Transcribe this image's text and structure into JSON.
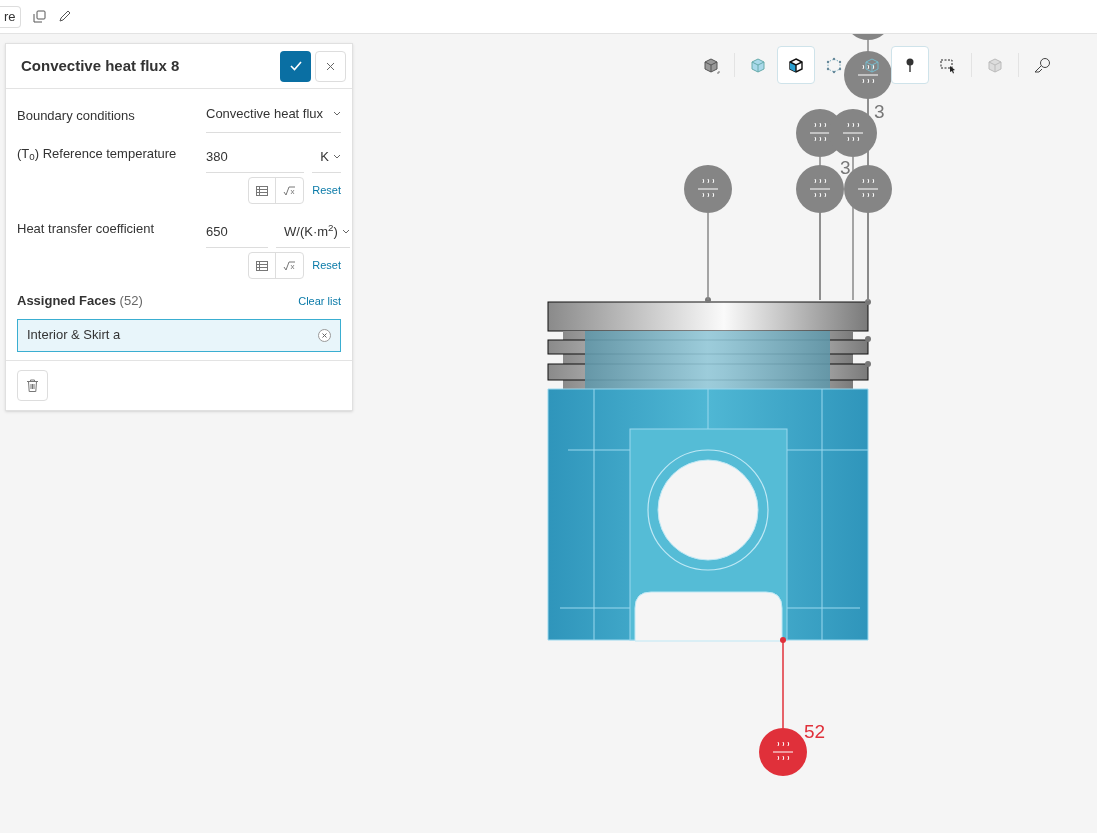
{
  "top_bar": {
    "button_label": "re"
  },
  "panel": {
    "title": "Convective heat flux 8",
    "rows": [
      {
        "kind": "select",
        "label": "Boundary conditions",
        "value": "Convective heat flux"
      },
      {
        "kind": "quantity",
        "label": "(T$_{0}$) Reference temperature",
        "value": "380",
        "unit": "K",
        "reset": "Reset"
      },
      {
        "kind": "quantity",
        "label": "Heat transfer coefficient",
        "value": "650",
        "unit": "W/(K·m$^{2}$)",
        "reset": "Reset"
      }
    ],
    "assigned": {
      "title": "Assigned Faces",
      "count": "(52)",
      "clear": "Clear list",
      "item": "Interior & Skirt a"
    }
  },
  "toolbar": [
    {
      "selected": false
    },
    {
      "selected": false
    },
    {
      "selected": true
    },
    {
      "selected": false
    },
    {
      "selected": false
    },
    {
      "selected": true
    },
    {
      "selected": false
    },
    {
      "selected": false
    },
    {
      "selected": false
    }
  ],
  "markers": [
    {
      "selected": false
    },
    {
      "selected": false
    },
    {
      "selected": false
    },
    {
      "selected": false
    },
    {
      "selected": false
    },
    {
      "selected": false
    },
    {
      "selected": false
    },
    {
      "selected": true
    }
  ],
  "marker_labels": [
    "3",
    "3",
    "52"
  ]
}
